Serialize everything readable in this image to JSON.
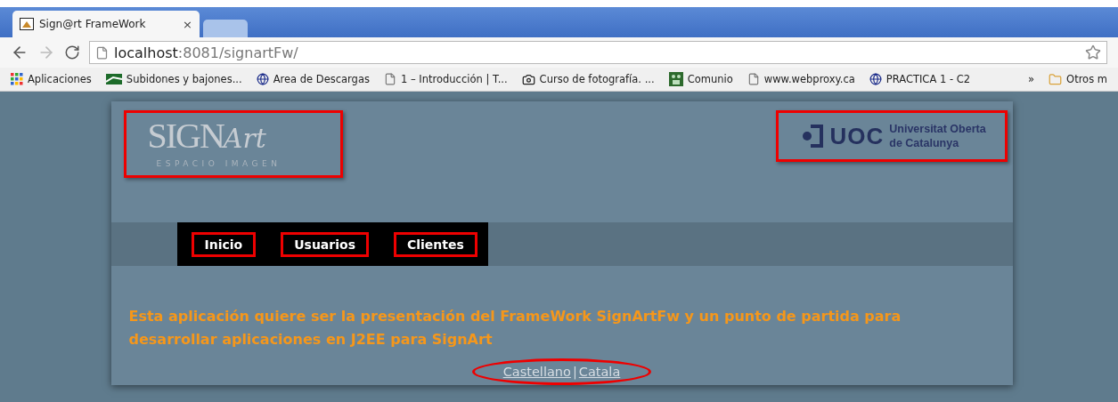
{
  "browser": {
    "tabs": [
      {
        "title": "Sign@rt FrameWork",
        "selected": true,
        "close": "×"
      },
      {
        "selected": false
      }
    ],
    "address": {
      "host": "localhost",
      "rest": ":8081/signartFw/"
    },
    "bookmarks": [
      {
        "label": "Aplicaciones",
        "kind": "apps"
      },
      {
        "label": "Subidones y bajones...",
        "kind": "chart"
      },
      {
        "label": "Area de Descargas",
        "kind": "globe"
      },
      {
        "label": "1 – Introducción | T...",
        "kind": "page"
      },
      {
        "label": "Curso de fotografía. ...",
        "kind": "camera"
      },
      {
        "label": "Comunio",
        "kind": "team"
      },
      {
        "label": "www.webproxy.ca",
        "kind": "page"
      },
      {
        "label": "PRACTICA 1 - C2",
        "kind": "globe"
      }
    ],
    "overflow": "»",
    "other_bookmarks": "Otros m"
  },
  "page": {
    "logo_left": {
      "main": "SIGN",
      "script": "Art",
      "tagline": "ESPACIO IMAGEN",
      "highlighted": true
    },
    "logo_right": {
      "mark": "UOC",
      "line1": "Universitat Oberta",
      "line2": "de Catalunya",
      "highlighted": true
    },
    "menu": [
      {
        "label": "Inicio",
        "highlighted": true
      },
      {
        "label": "Usuarios",
        "highlighted": true
      },
      {
        "label": "Clientes",
        "highlighted": true
      }
    ],
    "intro": "Esta aplicación quiere ser la presentación del FrameWork SignArtFw y un punto de partida para desarrollar aplicaciones en J2EE para SignArt",
    "languages": {
      "items": [
        "Castellano",
        "Catala"
      ],
      "separator": "|",
      "highlighted": true
    }
  }
}
